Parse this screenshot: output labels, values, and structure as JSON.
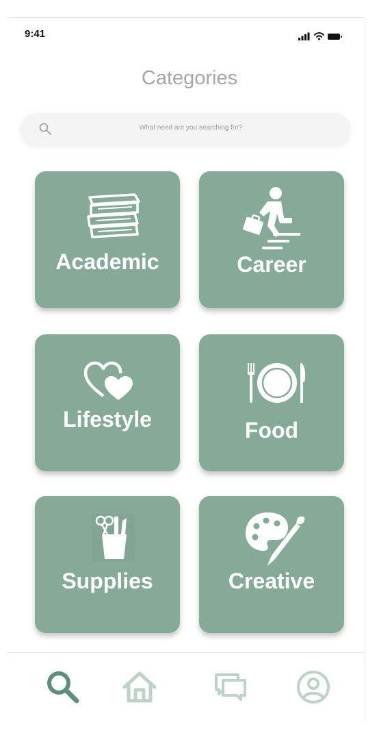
{
  "status_bar": {
    "time": "9:41"
  },
  "header": {
    "title": "Categories"
  },
  "search": {
    "placeholder": "What need are you searching for?"
  },
  "categories": [
    {
      "label": "Academic",
      "icon": "books-icon"
    },
    {
      "label": "Career",
      "icon": "career-climb-icon"
    },
    {
      "label": "Lifestyle",
      "icon": "hearts-icon"
    },
    {
      "label": "Food",
      "icon": "plate-utensils-icon"
    },
    {
      "label": "Supplies",
      "icon": "pencil-cup-icon"
    },
    {
      "label": "Creative",
      "icon": "palette-brush-icon"
    }
  ],
  "tab_bar": {
    "tabs": [
      {
        "icon": "search-icon",
        "active": true
      },
      {
        "icon": "home-icon",
        "active": false
      },
      {
        "icon": "chat-icon",
        "active": false
      },
      {
        "icon": "profile-icon",
        "active": false
      }
    ]
  },
  "colors": {
    "tile": "#86aa98",
    "active_tab": "#5e8f78",
    "inactive_tab": "#bcd4c8",
    "title": "#a6a6a6"
  }
}
